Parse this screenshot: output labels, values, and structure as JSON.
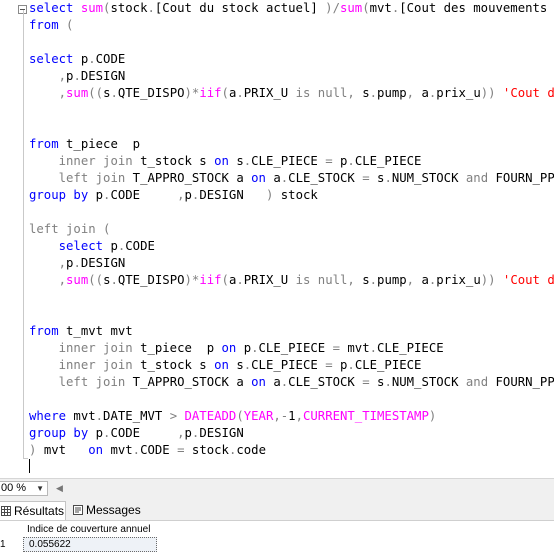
{
  "editor": {
    "lines": [
      [
        [
          "kw",
          "select "
        ],
        [
          "fn",
          "sum"
        ],
        [
          "gr",
          "("
        ],
        [
          "",
          "stock"
        ],
        [
          "gr",
          "."
        ],
        [
          "",
          "[Cout du stock actuel]"
        ],
        [
          "gr",
          " )/"
        ],
        [
          "fn",
          "sum"
        ],
        [
          "gr",
          "("
        ],
        [
          "",
          "mvt"
        ],
        [
          "gr",
          "."
        ],
        [
          "",
          "[Cout des mouvements de"
        ]
      ],
      [
        [
          "kw",
          "from"
        ],
        [
          "gr",
          " ("
        ]
      ],
      [],
      [
        [
          "kw",
          "select "
        ],
        [
          "",
          "p"
        ],
        [
          "gr",
          "."
        ],
        [
          "",
          "CODE"
        ]
      ],
      [
        [
          "",
          "    "
        ],
        [
          "gr",
          ","
        ],
        [
          "",
          "p"
        ],
        [
          "gr",
          "."
        ],
        [
          "",
          "DESIGN"
        ]
      ],
      [
        [
          "",
          "    "
        ],
        [
          "gr",
          ","
        ],
        [
          "fn",
          "sum"
        ],
        [
          "gr",
          "(("
        ],
        [
          "",
          "s"
        ],
        [
          "gr",
          "."
        ],
        [
          "",
          "QTE_DISPO"
        ],
        [
          "gr",
          ")*"
        ],
        [
          "fn",
          "iif"
        ],
        [
          "gr",
          "("
        ],
        [
          "",
          "a"
        ],
        [
          "gr",
          "."
        ],
        [
          "",
          "PRIX_U "
        ],
        [
          "gr",
          "is null, "
        ],
        [
          "",
          "s"
        ],
        [
          "gr",
          "."
        ],
        [
          "",
          "pump"
        ],
        [
          "gr",
          ", "
        ],
        [
          "",
          "a"
        ],
        [
          "gr",
          "."
        ],
        [
          "",
          "prix_u"
        ],
        [
          "gr",
          "))"
        ],
        [
          "str",
          " 'Cout du"
        ]
      ],
      [],
      [],
      [
        [
          "kw",
          "from "
        ],
        [
          "",
          "t_piece  p"
        ]
      ],
      [
        [
          "",
          "    "
        ],
        [
          "gr",
          "inner join "
        ],
        [
          "",
          "t_stock s "
        ],
        [
          "kw",
          "on "
        ],
        [
          "",
          "s"
        ],
        [
          "gr",
          "."
        ],
        [
          "",
          "CLE_PIECE "
        ],
        [
          "gr",
          "= "
        ],
        [
          "",
          "p"
        ],
        [
          "gr",
          "."
        ],
        [
          "",
          "CLE_PIECE"
        ]
      ],
      [
        [
          "",
          "    "
        ],
        [
          "gr",
          "left join "
        ],
        [
          "",
          "T_APPRO_STOCK a "
        ],
        [
          "kw",
          "on "
        ],
        [
          "",
          "a"
        ],
        [
          "gr",
          "."
        ],
        [
          "",
          "CLE_STOCK "
        ],
        [
          "gr",
          "= "
        ],
        [
          "",
          "s"
        ],
        [
          "gr",
          "."
        ],
        [
          "",
          "NUM_STOCK "
        ],
        [
          "gr",
          "and "
        ],
        [
          "",
          "FOURN_PPAL"
        ]
      ],
      [
        [
          "kw",
          "group by "
        ],
        [
          "",
          "p"
        ],
        [
          "gr",
          "."
        ],
        [
          "",
          "CODE     "
        ],
        [
          "gr",
          ","
        ],
        [
          "",
          "p"
        ],
        [
          "gr",
          "."
        ],
        [
          "",
          "DESIGN   "
        ],
        [
          "gr",
          ") "
        ],
        [
          "",
          "stock"
        ]
      ],
      [],
      [
        [
          "gr",
          "left join ("
        ]
      ],
      [
        [
          "",
          "    "
        ],
        [
          "kw",
          "select "
        ],
        [
          "",
          "p"
        ],
        [
          "gr",
          "."
        ],
        [
          "",
          "CODE"
        ]
      ],
      [
        [
          "",
          "    "
        ],
        [
          "gr",
          ","
        ],
        [
          "",
          "p"
        ],
        [
          "gr",
          "."
        ],
        [
          "",
          "DESIGN"
        ]
      ],
      [
        [
          "",
          "    "
        ],
        [
          "gr",
          ","
        ],
        [
          "fn",
          "sum"
        ],
        [
          "gr",
          "(("
        ],
        [
          "",
          "s"
        ],
        [
          "gr",
          "."
        ],
        [
          "",
          "QTE_DISPO"
        ],
        [
          "gr",
          ")*"
        ],
        [
          "fn",
          "iif"
        ],
        [
          "gr",
          "("
        ],
        [
          "",
          "a"
        ],
        [
          "gr",
          "."
        ],
        [
          "",
          "PRIX_U "
        ],
        [
          "gr",
          "is null, "
        ],
        [
          "",
          "s"
        ],
        [
          "gr",
          "."
        ],
        [
          "",
          "pump"
        ],
        [
          "gr",
          ", "
        ],
        [
          "",
          "a"
        ],
        [
          "gr",
          "."
        ],
        [
          "",
          "prix_u"
        ],
        [
          "gr",
          "))"
        ],
        [
          "str",
          " 'Cout des"
        ]
      ],
      [],
      [],
      [
        [
          "kw",
          "from "
        ],
        [
          "",
          "t_mvt mvt"
        ]
      ],
      [
        [
          "",
          "    "
        ],
        [
          "gr",
          "inner join "
        ],
        [
          "",
          "t_piece  p "
        ],
        [
          "kw",
          "on "
        ],
        [
          "",
          "p"
        ],
        [
          "gr",
          "."
        ],
        [
          "",
          "CLE_PIECE "
        ],
        [
          "gr",
          "= "
        ],
        [
          "",
          "mvt"
        ],
        [
          "gr",
          "."
        ],
        [
          "",
          "CLE_PIECE"
        ]
      ],
      [
        [
          "",
          "    "
        ],
        [
          "gr",
          "inner join "
        ],
        [
          "",
          "t_stock s "
        ],
        [
          "kw",
          "on "
        ],
        [
          "",
          "s"
        ],
        [
          "gr",
          "."
        ],
        [
          "",
          "CLE_PIECE "
        ],
        [
          "gr",
          "= "
        ],
        [
          "",
          "p"
        ],
        [
          "gr",
          "."
        ],
        [
          "",
          "CLE_PIECE"
        ]
      ],
      [
        [
          "",
          "    "
        ],
        [
          "gr",
          "left join "
        ],
        [
          "",
          "T_APPRO_STOCK a "
        ],
        [
          "kw",
          "on "
        ],
        [
          "",
          "a"
        ],
        [
          "gr",
          "."
        ],
        [
          "",
          "CLE_STOCK "
        ],
        [
          "gr",
          "= "
        ],
        [
          "",
          "s"
        ],
        [
          "gr",
          "."
        ],
        [
          "",
          "NUM_STOCK "
        ],
        [
          "gr",
          "and "
        ],
        [
          "",
          "FOURN_PPAL"
        ]
      ],
      [],
      [
        [
          "kw",
          "where "
        ],
        [
          "",
          "mvt"
        ],
        [
          "gr",
          "."
        ],
        [
          "",
          "DATE_MVT "
        ],
        [
          "gr",
          "> "
        ],
        [
          "fn",
          "DATEADD"
        ],
        [
          "gr",
          "("
        ],
        [
          "fn",
          "YEAR"
        ],
        [
          "gr",
          ",-"
        ],
        [
          "",
          "1"
        ],
        [
          "gr",
          ","
        ],
        [
          "fn",
          "CURRENT_TIMESTAMP"
        ],
        [
          "gr",
          ")"
        ]
      ],
      [
        [
          "kw",
          "group by "
        ],
        [
          "",
          "p"
        ],
        [
          "gr",
          "."
        ],
        [
          "",
          "CODE     "
        ],
        [
          "gr",
          ","
        ],
        [
          "",
          "p"
        ],
        [
          "gr",
          "."
        ],
        [
          "",
          "DESIGN"
        ]
      ],
      [
        [
          "gr",
          ") "
        ],
        [
          "",
          "mvt   "
        ],
        [
          "kw",
          "on "
        ],
        [
          "",
          "mvt"
        ],
        [
          "gr",
          "."
        ],
        [
          "",
          "CODE "
        ],
        [
          "gr",
          "= "
        ],
        [
          "",
          "stock"
        ],
        [
          "gr",
          "."
        ],
        [
          "",
          "code"
        ]
      ],
      [
        [
          "cursor",
          ""
        ]
      ]
    ]
  },
  "statusbar": {
    "zoom": "00 %"
  },
  "tabs": [
    {
      "label": "Résultats",
      "icon": "grid-icon"
    },
    {
      "label": "Messages",
      "icon": "messages-icon"
    }
  ],
  "results": {
    "columns": [
      "Indice de couverture annuel"
    ],
    "rows": [
      {
        "num": "1",
        "values": [
          "0.055622"
        ]
      }
    ]
  },
  "colors": {
    "keyword": "#0000ff",
    "function": "#ff00ff",
    "operator": "#808080",
    "string": "#ff0000"
  }
}
